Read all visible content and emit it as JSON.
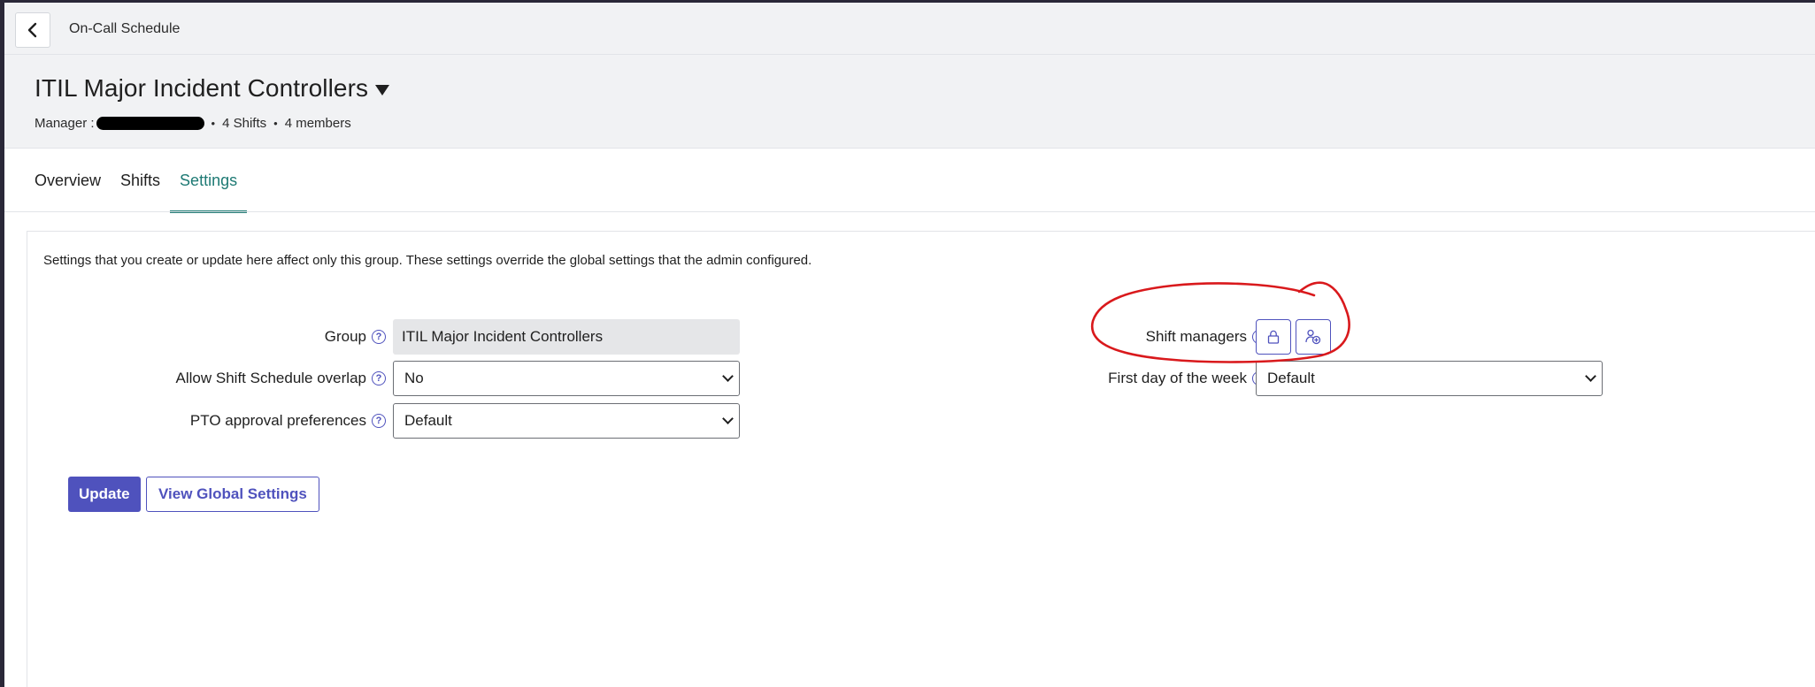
{
  "topbar": {
    "back_icon": "chevron-left-icon",
    "breadcrumb": "On-Call Schedule"
  },
  "header": {
    "title": "ITIL Major Incident Controllers",
    "manager_label": "Manager :",
    "shifts": "4 Shifts",
    "members": "4 members",
    "separator": "•"
  },
  "tabs": [
    {
      "label": "Overview",
      "active": false
    },
    {
      "label": "Shifts",
      "active": false
    },
    {
      "label": "Settings",
      "active": true
    }
  ],
  "settings": {
    "intro": "Settings that you create or update here affect only this group. These settings override the global settings that the admin configured.",
    "group": {
      "label": "Group",
      "value": "ITIL Major Incident Controllers"
    },
    "overlap": {
      "label": "Allow Shift Schedule overlap",
      "value": "No"
    },
    "pto": {
      "label": "PTO approval preferences",
      "value": "Default"
    },
    "shift_managers": {
      "label": "Shift managers",
      "icons": [
        "lock-icon",
        "add-user-icon"
      ]
    },
    "first_day": {
      "label": "First day of the week",
      "value": "Default"
    },
    "help_glyph": "?"
  },
  "actions": {
    "update": "Update",
    "view_global": "View Global Settings"
  },
  "colors": {
    "accent": "#4f52bd",
    "tab_active": "#1e7a74",
    "annotation": "#d9191c"
  }
}
